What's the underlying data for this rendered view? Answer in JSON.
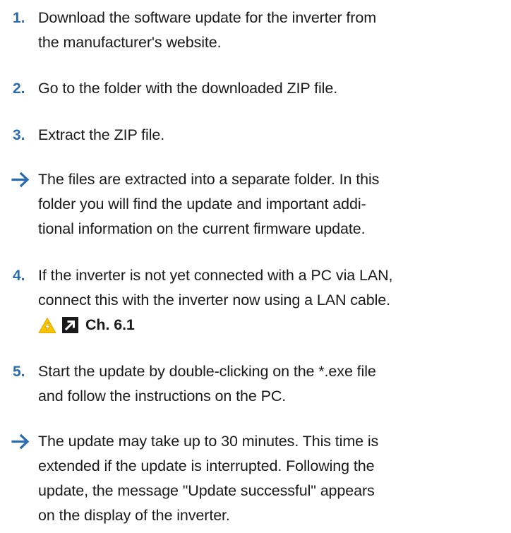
{
  "steps": [
    {
      "marker": "1.",
      "lines": [
        "Download the software update for the inverter from",
        "the manufacturer's website."
      ]
    },
    {
      "marker": "2.",
      "lines": [
        "Go to the folder with the downloaded ZIP file."
      ]
    },
    {
      "marker": "3.",
      "lines": [
        "Extract the ZIP file."
      ]
    },
    {
      "marker": "arrow",
      "lines": [
        "The files are extracted into a separate folder. In this",
        "folder you will find the update and important addi-",
        "tional information on the current firmware update."
      ]
    },
    {
      "marker": "4.",
      "lines": [
        "If the inverter is not yet connected with a PC via LAN,",
        "connect this with the inverter now using a LAN cable."
      ],
      "reference": "Ch. 6.1"
    },
    {
      "marker": "5.",
      "lines": [
        "Start the update by double-clicking on the *.exe file",
        "and follow the instructions on the PC."
      ]
    },
    {
      "marker": "arrow",
      "lines": [
        "The update may take up to 30 minutes. This time is",
        "extended if the update is interrupted. Following the",
        "update, the message \"Update successful\" appears",
        "on the display of the inverter."
      ]
    }
  ],
  "colors": {
    "marker": "#2b6cb0",
    "warning_fill": "#f5c400",
    "reference_box": "#1a1a1a"
  },
  "icons": {
    "result": "arrow-right-icon",
    "warning": "electrical-warning-icon",
    "reference": "cross-reference-arrow-icon"
  }
}
